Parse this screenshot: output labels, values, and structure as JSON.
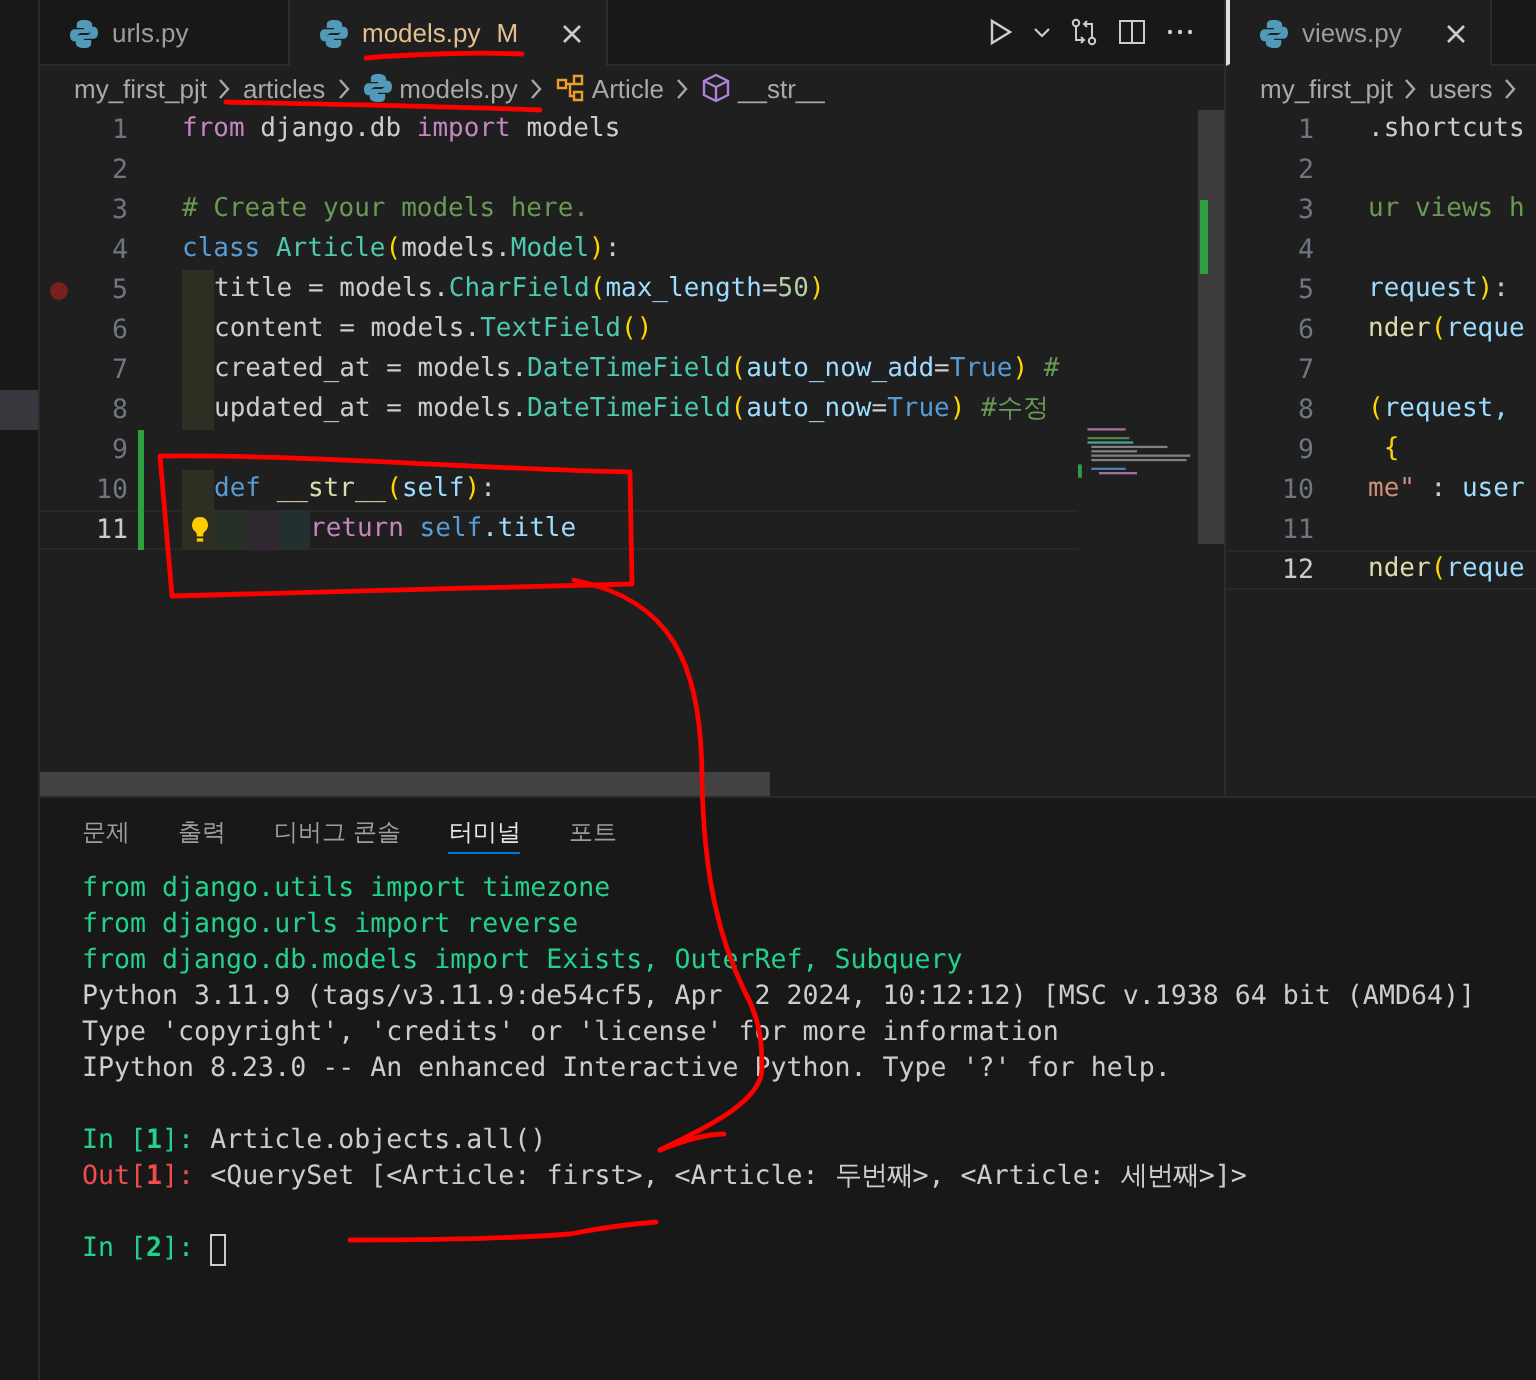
{
  "editor_groups": [
    {
      "tabs": [
        {
          "label": "urls.py",
          "selected": false,
          "modified": false
        },
        {
          "label": "models.py",
          "selected": true,
          "modified": true,
          "badge": "M"
        }
      ],
      "breadcrumb": [
        {
          "label": "my_first_pjt",
          "kind": "folder"
        },
        {
          "label": "articles",
          "kind": "folder"
        },
        {
          "label": "models.py",
          "kind": "file"
        },
        {
          "label": "Article",
          "kind": "class"
        },
        {
          "label": "__str__",
          "kind": "method"
        }
      ],
      "lines": [
        {
          "number": "1",
          "current": false,
          "breakpoint": false,
          "added": false,
          "hint": false,
          "tokens": [
            {
              "text": "from",
              "kind": "kw"
            },
            {
              "text": " django.db ",
              "kind": "p"
            },
            {
              "text": "import",
              "kind": "kw"
            },
            {
              "text": " models",
              "kind": "p"
            }
          ]
        },
        {
          "number": "2",
          "current": false,
          "breakpoint": false,
          "added": false,
          "hint": false
        },
        {
          "number": "3",
          "current": false,
          "breakpoint": false,
          "added": false,
          "hint": false,
          "tokens": [
            {
              "text": "# Create your models here.",
              "kind": "cmt"
            }
          ]
        },
        {
          "number": "4",
          "current": false,
          "breakpoint": false,
          "added": false,
          "hint": false,
          "tokens": [
            {
              "text": "class ",
              "kind": "def"
            },
            {
              "text": "Article",
              "kind": "cls"
            },
            {
              "text": "(",
              "kind": "b1"
            },
            {
              "text": "models.",
              "kind": "p"
            },
            {
              "text": "Model",
              "kind": "cls"
            },
            {
              "text": ")",
              "kind": "b1"
            },
            {
              "text": ":",
              "kind": "p"
            }
          ]
        },
        {
          "number": "5",
          "current": false,
          "breakpoint": true,
          "added": false,
          "hint": false,
          "guides": [
            {
              "color": "#2e2e22"
            }
          ],
          "tokens": [
            {
              "text": "title = models.",
              "kind": "p"
            },
            {
              "text": "CharField",
              "kind": "cls"
            },
            {
              "text": "(",
              "kind": "b1"
            },
            {
              "text": "max_length",
              "kind": "var"
            },
            {
              "text": "=",
              "kind": "p"
            },
            {
              "text": "50",
              "kind": "num"
            },
            {
              "text": ")",
              "kind": "b1"
            }
          ]
        },
        {
          "number": "6",
          "current": false,
          "breakpoint": false,
          "added": false,
          "hint": false,
          "guides": [
            {
              "color": "#2e2e22"
            }
          ],
          "tokens": [
            {
              "text": "content = models.",
              "kind": "p"
            },
            {
              "text": "TextField",
              "kind": "cls"
            },
            {
              "text": "()",
              "kind": "b1"
            }
          ]
        },
        {
          "number": "7",
          "current": false,
          "breakpoint": false,
          "added": false,
          "hint": false,
          "guides": [
            {
              "color": "#2e2e22"
            }
          ],
          "tokens": [
            {
              "text": "created_at = models.",
              "kind": "p"
            },
            {
              "text": "DateTimeField",
              "kind": "cls"
            },
            {
              "text": "(",
              "kind": "b1"
            },
            {
              "text": "auto_now_add",
              "kind": "var"
            },
            {
              "text": "=",
              "kind": "p"
            },
            {
              "text": "True",
              "kind": "def"
            },
            {
              "text": ")",
              "kind": "b1"
            },
            {
              "text": " #",
              "kind": "cmt"
            }
          ]
        },
        {
          "number": "8",
          "current": false,
          "breakpoint": false,
          "added": false,
          "hint": false,
          "guides": [
            {
              "color": "#2e2e22"
            }
          ],
          "tokens": [
            {
              "text": "updated_at = models.",
              "kind": "p"
            },
            {
              "text": "DateTimeField",
              "kind": "cls"
            },
            {
              "text": "(",
              "kind": "b1"
            },
            {
              "text": "auto_now",
              "kind": "var"
            },
            {
              "text": "=",
              "kind": "p"
            },
            {
              "text": "True",
              "kind": "def"
            },
            {
              "text": ")",
              "kind": "b1"
            },
            {
              "text": " #수정",
              "kind": "cmt"
            }
          ]
        },
        {
          "number": "9",
          "current": false,
          "breakpoint": false,
          "added": true,
          "hint": false
        },
        {
          "number": "10",
          "current": false,
          "breakpoint": false,
          "added": true,
          "hint": false,
          "guides": [
            {
              "color": "#2e2e22"
            }
          ],
          "tokens": [
            {
              "text": "def ",
              "kind": "def"
            },
            {
              "text": "__str__",
              "kind": "fn"
            },
            {
              "text": "(",
              "kind": "b1"
            },
            {
              "text": "self",
              "kind": "var"
            },
            {
              "text": ")",
              "kind": "b1"
            },
            {
              "text": ":",
              "kind": "p"
            }
          ]
        },
        {
          "number": "11",
          "current": true,
          "breakpoint": false,
          "added": true,
          "hint": true,
          "guides": [
            {
              "color": "#2e2e22"
            },
            {
              "color": "#263026"
            },
            {
              "color": "#302830"
            },
            {
              "color": "#243030"
            }
          ],
          "tokens": [
            {
              "text": "return ",
              "kind": "kw"
            },
            {
              "text": "self",
              "kind": "def"
            },
            {
              "text": ".title",
              "kind": "var"
            }
          ]
        }
      ]
    },
    {
      "tabs": [
        {
          "label": "views.py",
          "selected": true,
          "modified": false
        }
      ],
      "breadcrumb": [
        {
          "label": "my_first_pjt",
          "kind": "folder"
        },
        {
          "label": "users",
          "kind": "folder"
        }
      ],
      "lines": [
        {
          "number": "1",
          "current": false,
          "tokens": [
            {
              "text": ".shortcuts",
              "kind": "p"
            }
          ]
        },
        {
          "number": "2",
          "current": false
        },
        {
          "number": "3",
          "current": false,
          "tokens": [
            {
              "text": "ur views h",
              "kind": "cmt"
            }
          ]
        },
        {
          "number": "4",
          "current": false
        },
        {
          "number": "5",
          "current": false,
          "tokens": [
            {
              "text": "request",
              "kind": "var"
            },
            {
              "text": ")",
              "kind": "b1"
            },
            {
              "text": ":",
              "kind": "p"
            }
          ]
        },
        {
          "number": "6",
          "current": false,
          "tokens": [
            {
              "text": "nder",
              "kind": "fn"
            },
            {
              "text": "(",
              "kind": "b1"
            },
            {
              "text": "reque",
              "kind": "var"
            }
          ]
        },
        {
          "number": "7",
          "current": false
        },
        {
          "number": "8",
          "current": false,
          "tokens": [
            {
              "text": "(",
              "kind": "b1"
            },
            {
              "text": "request,",
              "kind": "var"
            }
          ]
        },
        {
          "number": "9",
          "current": false,
          "tokens": [
            {
              "text": " {",
              "kind": "b1"
            }
          ]
        },
        {
          "number": "10",
          "current": false,
          "tokens": [
            {
              "text": "me\"",
              "kind": "str"
            },
            {
              "text": " : ",
              "kind": "p"
            },
            {
              "text": "user",
              "kind": "var"
            }
          ]
        },
        {
          "number": "11",
          "current": false
        },
        {
          "number": "12",
          "current": true,
          "tokens": [
            {
              "text": "nder",
              "kind": "fn"
            },
            {
              "text": "(",
              "kind": "b1"
            },
            {
              "text": "reque",
              "kind": "var"
            }
          ]
        }
      ]
    }
  ],
  "panel": {
    "tabs": [
      {
        "label": "문제",
        "selected": false
      },
      {
        "label": "출력",
        "selected": false
      },
      {
        "label": "디버그 콘솔",
        "selected": false
      },
      {
        "label": "터미널",
        "selected": true
      },
      {
        "label": "포트",
        "selected": false
      }
    ],
    "terminal": [
      {
        "cursor": false,
        "segments": [
          {
            "text": "from django.utils import timezone",
            "kind": "g"
          }
        ]
      },
      {
        "cursor": false,
        "segments": [
          {
            "text": "from django.urls import reverse",
            "kind": "g"
          }
        ]
      },
      {
        "cursor": false,
        "segments": [
          {
            "text": "from django.db.models import Exists, OuterRef, Subquery",
            "kind": "g"
          }
        ]
      },
      {
        "cursor": false,
        "segments": [
          {
            "text": "Python 3.11.9 (tags/v3.11.9:de54cf5, Apr  2 2024, 10:12:12) [MSC v.1938 64 bit (AMD64)]",
            "kind": "p"
          }
        ]
      },
      {
        "cursor": false,
        "segments": [
          {
            "text": "Type 'copyright', 'credits' or 'license' for more information",
            "kind": "p"
          }
        ]
      },
      {
        "cursor": false,
        "segments": [
          {
            "text": "IPython 8.23.0 -- An enhanced Interactive Python. Type '?' for help.",
            "kind": "p"
          }
        ]
      },
      {
        "cursor": false
      },
      {
        "cursor": false,
        "segments": [
          {
            "text": "In [",
            "kind": "g"
          },
          {
            "text": "1",
            "kind": "gb"
          },
          {
            "text": "]: ",
            "kind": "g"
          },
          {
            "text": "Article.objects.all()",
            "kind": "p"
          }
        ]
      },
      {
        "cursor": false,
        "segments": [
          {
            "text": "Out[",
            "kind": "r"
          },
          {
            "text": "1",
            "kind": "rb"
          },
          {
            "text": "]: ",
            "kind": "r"
          },
          {
            "text": "<QuerySet [<Article: first>, <Article: 두번째>, <Article: 세번째>]>",
            "kind": "p"
          }
        ]
      },
      {
        "cursor": false
      },
      {
        "cursor": true,
        "segments": [
          {
            "text": "In [",
            "kind": "g"
          },
          {
            "text": "2",
            "kind": "gb"
          },
          {
            "text": "]: ",
            "kind": "g"
          }
        ]
      }
    ]
  },
  "annotations": [
    {
      "kind": "underline"
    },
    {
      "kind": "underline"
    },
    {
      "kind": "box"
    },
    {
      "kind": "arrow"
    },
    {
      "kind": "underline"
    }
  ]
}
